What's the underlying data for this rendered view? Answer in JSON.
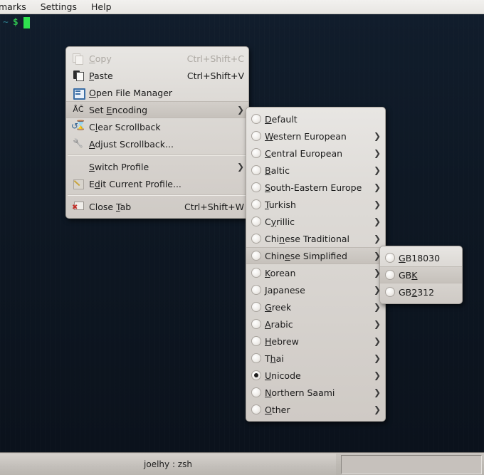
{
  "menubar": {
    "items": [
      {
        "label": "marks"
      },
      {
        "label": "Settings"
      },
      {
        "label": "Help"
      }
    ]
  },
  "terminal": {
    "prompt_path": "~",
    "prompt_symbol": "$",
    "cursor": ""
  },
  "statusbar": {
    "tab_label": "joelhy : zsh"
  },
  "context_menu": {
    "items": [
      {
        "label_pre": "",
        "label_key": "C",
        "label_post": "opy",
        "accel": "Ctrl+Shift+C",
        "icon": "copy-icon",
        "disabled": true,
        "submenu": false,
        "selected": false
      },
      {
        "label_pre": "",
        "label_key": "P",
        "label_post": "aste",
        "accel": "Ctrl+Shift+V",
        "icon": "paste-icon",
        "disabled": false,
        "submenu": false,
        "selected": false
      },
      {
        "label_pre": "",
        "label_key": "O",
        "label_post": "pen File Manager",
        "accel": "",
        "icon": "file-manager-icon",
        "disabled": false,
        "submenu": false,
        "selected": false
      },
      {
        "label_pre": "Set ",
        "label_key": "E",
        "label_post": "ncoding",
        "accel": "",
        "icon": "set-encoding-icon",
        "disabled": false,
        "submenu": true,
        "selected": true
      },
      {
        "label_pre": "C",
        "label_key": "l",
        "label_post": "ear Scrollback",
        "accel": "",
        "icon": "clear-scrollback-icon",
        "disabled": false,
        "submenu": false,
        "selected": false
      },
      {
        "label_pre": "",
        "label_key": "A",
        "label_post": "djust Scrollback...",
        "accel": "",
        "icon": "adjust-scrollback-icon",
        "disabled": false,
        "submenu": false,
        "selected": false
      },
      {
        "separator": true
      },
      {
        "label_pre": "",
        "label_key": "S",
        "label_post": "witch Profile",
        "accel": "",
        "icon": "",
        "disabled": false,
        "submenu": true,
        "selected": false
      },
      {
        "label_pre": "E",
        "label_key": "d",
        "label_post": "it Current Profile...",
        "accel": "",
        "icon": "edit-profile-icon",
        "disabled": false,
        "submenu": false,
        "selected": false
      },
      {
        "separator": true
      },
      {
        "label_pre": "Close ",
        "label_key": "T",
        "label_post": "ab",
        "accel": "Ctrl+Shift+W",
        "icon": "close-tab-icon",
        "disabled": false,
        "submenu": false,
        "selected": false
      }
    ]
  },
  "encoding_menu": {
    "items": [
      {
        "label_pre": "",
        "label_key": "D",
        "label_post": "efault",
        "submenu": false,
        "checked": false,
        "selected": false
      },
      {
        "label_pre": "",
        "label_key": "W",
        "label_post": "estern European",
        "submenu": true,
        "checked": false,
        "selected": false
      },
      {
        "label_pre": "",
        "label_key": "C",
        "label_post": "entral European",
        "submenu": true,
        "checked": false,
        "selected": false
      },
      {
        "label_pre": "",
        "label_key": "B",
        "label_post": "altic",
        "submenu": true,
        "checked": false,
        "selected": false
      },
      {
        "label_pre": "",
        "label_key": "S",
        "label_post": "outh-Eastern Europe",
        "submenu": true,
        "checked": false,
        "selected": false
      },
      {
        "label_pre": "",
        "label_key": "T",
        "label_post": "urkish",
        "submenu": true,
        "checked": false,
        "selected": false
      },
      {
        "label_pre": "C",
        "label_key": "y",
        "label_post": "rillic",
        "submenu": true,
        "checked": false,
        "selected": false
      },
      {
        "label_pre": "Chi",
        "label_key": "n",
        "label_post": "ese Traditional",
        "submenu": true,
        "checked": false,
        "selected": false
      },
      {
        "label_pre": "Chin",
        "label_key": "e",
        "label_post": "se Simplified",
        "submenu": true,
        "checked": false,
        "selected": true
      },
      {
        "label_pre": "",
        "label_key": "K",
        "label_post": "orean",
        "submenu": true,
        "checked": false,
        "selected": false
      },
      {
        "label_pre": "",
        "label_key": "J",
        "label_post": "apanese",
        "submenu": true,
        "checked": false,
        "selected": false
      },
      {
        "label_pre": "",
        "label_key": "G",
        "label_post": "reek",
        "submenu": true,
        "checked": false,
        "selected": false
      },
      {
        "label_pre": "",
        "label_key": "A",
        "label_post": "rabic",
        "submenu": true,
        "checked": false,
        "selected": false
      },
      {
        "label_pre": "",
        "label_key": "H",
        "label_post": "ebrew",
        "submenu": true,
        "checked": false,
        "selected": false
      },
      {
        "label_pre": "T",
        "label_key": "h",
        "label_post": "ai",
        "submenu": true,
        "checked": false,
        "selected": false
      },
      {
        "label_pre": "",
        "label_key": "U",
        "label_post": "nicode",
        "submenu": true,
        "checked": true,
        "selected": false
      },
      {
        "label_pre": "",
        "label_key": "N",
        "label_post": "orthern Saami",
        "submenu": true,
        "checked": false,
        "selected": false
      },
      {
        "label_pre": "",
        "label_key": "O",
        "label_post": "ther",
        "submenu": true,
        "checked": false,
        "selected": false
      }
    ]
  },
  "gb_menu": {
    "items": [
      {
        "label_pre": "",
        "label_key": "G",
        "label_post": "B18030",
        "checked": false,
        "selected": false
      },
      {
        "label_pre": "GB",
        "label_key": "K",
        "label_post": "",
        "checked": false,
        "selected": true
      },
      {
        "label_pre": "GB",
        "label_key": "2",
        "label_post": "312",
        "checked": false,
        "selected": false
      }
    ]
  },
  "glyphs": {
    "submenu_arrow": "❯",
    "encoding_icon_text": "ÅČ"
  }
}
